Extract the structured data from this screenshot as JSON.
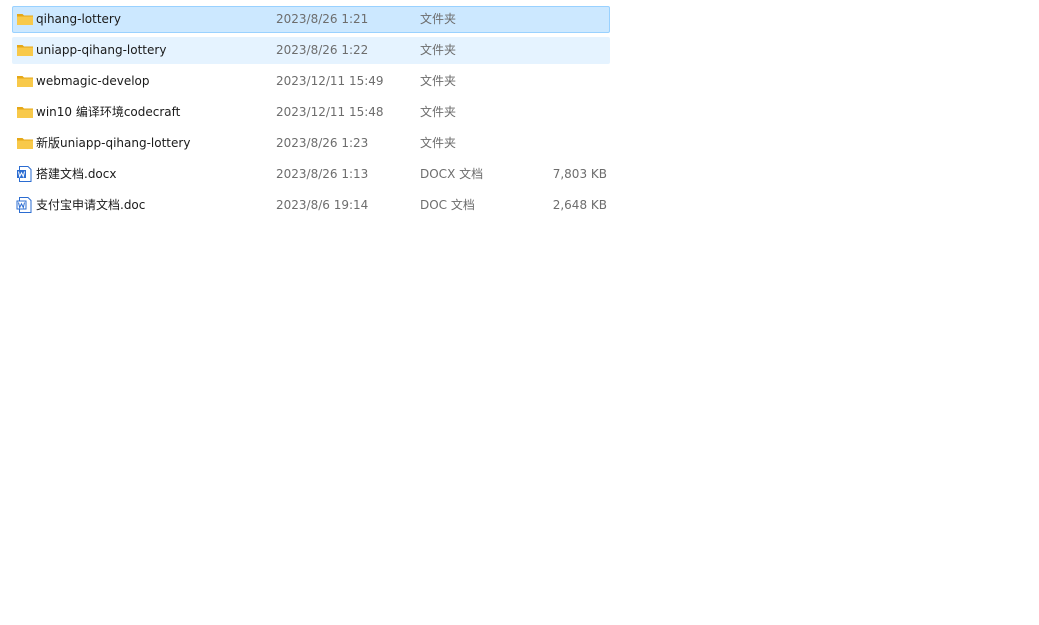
{
  "files": [
    {
      "name": "qihang-lottery",
      "date": "2023/8/26 1:21",
      "type": "文件夹",
      "size": "",
      "icon": "folder-icon",
      "state": "selected"
    },
    {
      "name": "uniapp-qihang-lottery",
      "date": "2023/8/26 1:22",
      "type": "文件夹",
      "size": "",
      "icon": "folder-icon",
      "state": "hover"
    },
    {
      "name": "webmagic-develop",
      "date": "2023/12/11 15:49",
      "type": "文件夹",
      "size": "",
      "icon": "folder-icon",
      "state": ""
    },
    {
      "name": "win10 编译环境codecraft",
      "date": "2023/12/11 15:48",
      "type": "文件夹",
      "size": "",
      "icon": "folder-icon",
      "state": ""
    },
    {
      "name": "新版uniapp-qihang-lottery",
      "date": "2023/8/26 1:23",
      "type": "文件夹",
      "size": "",
      "icon": "folder-icon",
      "state": ""
    },
    {
      "name": "搭建文档.docx",
      "date": "2023/8/26 1:13",
      "type": "DOCX 文档",
      "size": "7,803 KB",
      "icon": "word-docx-icon",
      "state": ""
    },
    {
      "name": "支付宝申请文档.doc",
      "date": "2023/8/6 19:14",
      "type": "DOC 文档",
      "size": "2,648 KB",
      "icon": "word-doc-icon",
      "state": ""
    }
  ],
  "colors": {
    "selected_bg": "#cce8ff",
    "selected_border": "#99d1ff",
    "hover_bg": "#e5f3ff",
    "folder": "#f8c94a",
    "word": "#2b6cd1"
  }
}
